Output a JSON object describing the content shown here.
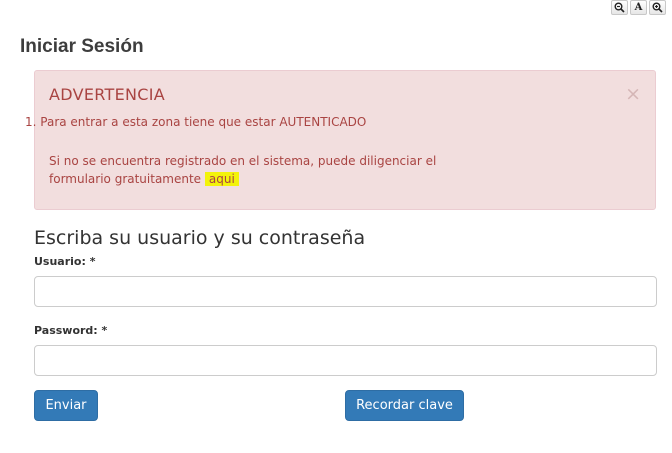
{
  "font_tools": [
    {
      "label": "🔍",
      "icon": "zoom-out-icon"
    },
    {
      "label": "A",
      "icon": "font-reset-icon"
    },
    {
      "label": "🔍",
      "icon": "zoom-in-icon"
    }
  ],
  "page": {
    "title": "Iniciar Sesión"
  },
  "alert": {
    "title": "ADVERTENCIA",
    "close": "×",
    "item1": "1. Para entrar a esta zona tiene que estar AUTENTICADO",
    "message_line1": "Si no se encuentra registrado en el sistema, puede diligenciar el",
    "message_line2": "formulario gratuitamente",
    "link": "aqui",
    "colors": {
      "background": "#f2dede",
      "text": "#a94442",
      "highlight": "#f3f30a"
    }
  },
  "form": {
    "subtitle": "Escriba su usuario y su contraseña",
    "user_label": "Usuario: *",
    "user_value": "",
    "password_label": "Password: *",
    "password_value": ""
  },
  "buttons": {
    "submit": "Enviar",
    "recover": "Recordar clave",
    "color": "#337ab7"
  }
}
